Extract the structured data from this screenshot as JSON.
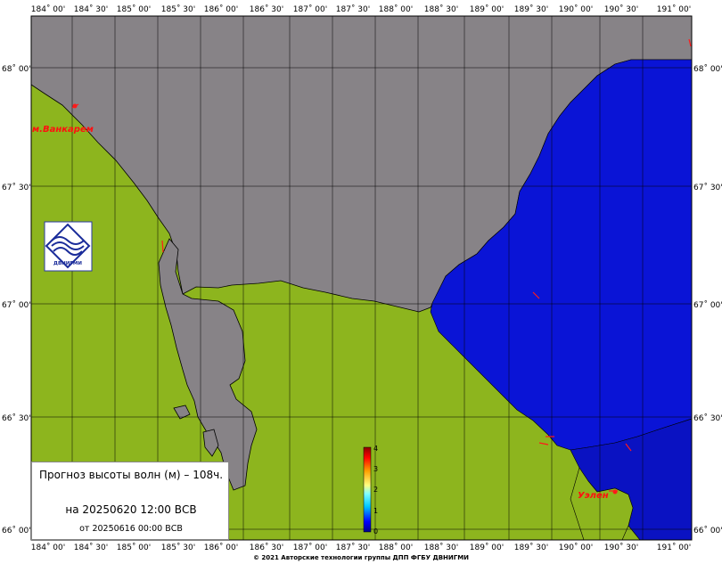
{
  "map": {
    "lon_labels": [
      "184˚ 00'",
      "184˚ 30'",
      "185˚ 00'",
      "185˚ 30'",
      "186˚ 00'",
      "186˚ 30'",
      "187˚ 00'",
      "187˚ 30'",
      "188˚ 00'",
      "188˚ 30'",
      "189˚ 00'",
      "189˚ 30'",
      "190˚ 00'",
      "190˚ 30'",
      "191˚ 00'"
    ],
    "lat_labels": [
      "68˚ 00'",
      "67˚ 30'",
      "67˚ 00'",
      "66˚ 30'",
      "66˚ 00'"
    ],
    "places": {
      "vankarem": "м.Ванкарем",
      "uelen": "Уэлен"
    },
    "colors": {
      "land": "#8db51e",
      "sea_gray": "#878387",
      "wave_low": "#0a14d6",
      "wave_lower": "#0a12c2",
      "arrow": "#ff1a1a"
    }
  },
  "colorbar": {
    "ticks": [
      "4",
      "3",
      "2",
      "1",
      "0"
    ],
    "range": [
      0,
      4
    ],
    "unit": "м"
  },
  "logo": {
    "text": "ДВНИГМИ"
  },
  "info": {
    "title": "Прогноз высоты волн (м) – 108ч.",
    "valid": "на 20250620 12:00 ВСВ",
    "issued": "от 20250616 00:00 ВСВ"
  },
  "footer": {
    "copyright": "© 2021 Авторские технологии группы ДПП ФГБУ ДВНИГМИ"
  }
}
